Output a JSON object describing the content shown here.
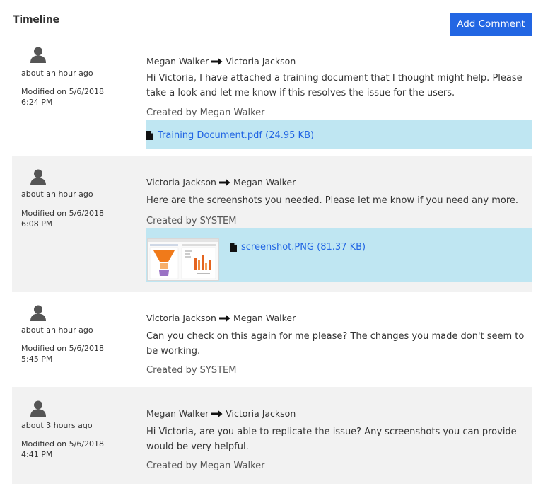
{
  "header": {
    "title": "Timeline",
    "add_button": "Add Comment"
  },
  "entries": [
    {
      "ago": "about an hour ago",
      "modified": "Modified on 5/6/2018 6:24 PM",
      "from": "Megan Walker",
      "to": "Victoria Jackson",
      "text": "Hi Victoria, I have attached a training document that I thought might help. Please take a look and let me know if this resolves the issue for the users.",
      "created_by": "Created by Megan Walker",
      "attachment": "Training Document.pdf (24.95 KB)"
    },
    {
      "ago": "about an hour ago",
      "modified": "Modified on 5/6/2018 6:08 PM",
      "from": "Victoria Jackson",
      "to": "Megan Walker",
      "text": "Here are the screenshots you needed. Please let me know if you need any more.",
      "created_by": "Created by SYSTEM",
      "attachment": "screenshot.PNG (81.37 KB)"
    },
    {
      "ago": "about an hour ago",
      "modified": "Modified on 5/6/2018 5:45 PM",
      "from": "Victoria Jackson",
      "to": "Megan Walker",
      "text": "Can you check on this again for me please? The changes you made don't seem to be working.",
      "created_by": "Created by SYSTEM"
    },
    {
      "ago": "about 3 hours ago",
      "modified": "Modified on 5/6/2018 4:41 PM",
      "from": "Megan Walker",
      "to": "Victoria Jackson",
      "text": "Hi Victoria, are you able to replicate the issue? Any screenshots you can provide would be very helpful.",
      "created_by": "Created by Megan Walker"
    }
  ],
  "icons": {
    "avatar": "user-silhouette-icon",
    "arrow": "right-arrow-icon",
    "file": "file-icon"
  },
  "colors": {
    "accent": "#2266e3",
    "attachment_bg": "#bfe6f2",
    "shaded_row": "#f2f2f2"
  }
}
